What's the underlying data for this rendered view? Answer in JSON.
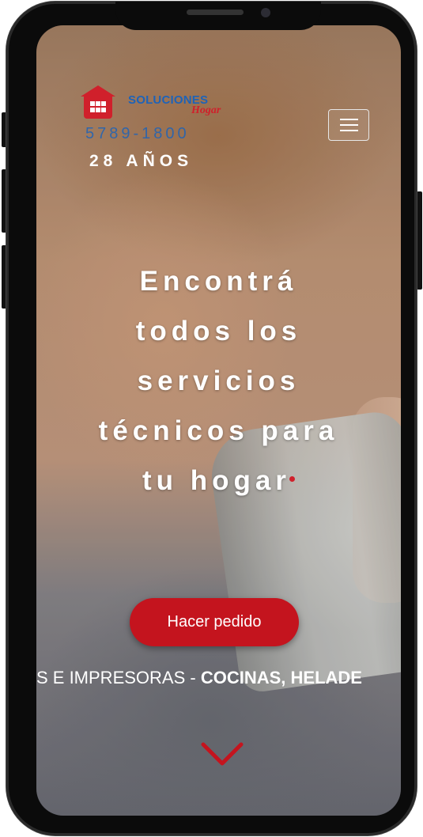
{
  "brand": {
    "name": "SOLUCIONES",
    "subname": "Hogar",
    "phone": "5789-1800",
    "years": "28 AÑOS"
  },
  "hero": {
    "lines": [
      "Encontrá",
      "todos los",
      "servicios",
      "técnicos para",
      "tu hogar"
    ]
  },
  "cta": {
    "label": "Hacer pedido"
  },
  "ticker": {
    "regular": "S E IMPRESORAS - ",
    "bold": "COCINAS, HELADE"
  },
  "colors": {
    "accent": "#c4141e",
    "brand_blue": "#1e63b8"
  },
  "icons": [
    "logo-house-icon",
    "hamburger-menu-icon",
    "chevron-down-icon"
  ]
}
